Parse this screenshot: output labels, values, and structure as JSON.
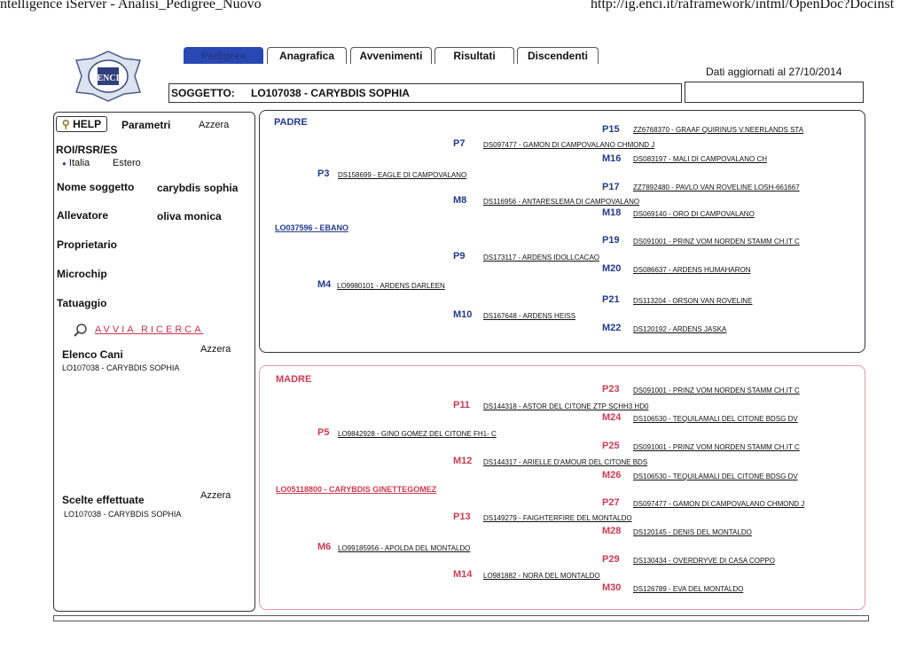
{
  "browser": {
    "title": "ntelligence iServer - Analisi_Pedigree_Nuovo",
    "url": "http://ig.enci.it/raframework/intml/OpenDoc?Docinst"
  },
  "tabs": [
    {
      "label": "Pedigree"
    },
    {
      "label": "Anagrafica"
    },
    {
      "label": "Avvenimenti"
    },
    {
      "label": "Risultati"
    },
    {
      "label": "Discendenti"
    }
  ],
  "updated": "Dati aggiornati al 27/10/2014",
  "subject": {
    "label": "SOGGETTO:",
    "value": "LO107038 - CARYBDIS SOPHIA"
  },
  "left": {
    "help": "HELP",
    "parametri": "Parametri",
    "azzera": "Azzera",
    "roi": "ROI/RSR/ES",
    "italia": "Italia",
    "estero": "Estero",
    "nome_label": "Nome soggetto",
    "nome_value": "carybdis sophia",
    "allevatore_label": "Allevatore",
    "allevatore_value": "oliva monica",
    "proprietario": "Proprietario",
    "microchip": "Microchip",
    "tatuaggio": "Tatuaggio",
    "search": "AVVIA RICERCA",
    "elenco": "Elenco Cani",
    "elenco_item": "LO107038 - CARYBDIS SOPHIA",
    "scelte": "Scelte effettuate",
    "scelte_item": "LO107038 - CARYBDIS SOPHIA"
  },
  "padre": {
    "title": "PADRE",
    "sire": "LO037596 - EBANO",
    "entries": [
      {
        "code": "P15",
        "name": "ZZ6768370 - GRAAF QUIRINUS V.NEERLANDS STA"
      },
      {
        "code": "P7",
        "name": "DS097477 - GAMON DI CAMPOVALANO CHMOND J"
      },
      {
        "code": "M16",
        "name": "DS083197 - MALI DI CAMPOVALANO CH"
      },
      {
        "code": "P3",
        "name": "DS158699 - EAGLE DI CAMPOVALANO"
      },
      {
        "code": "P17",
        "name": "ZZ7892480 - PAVLO VAN ROVELINE LOSH-661667"
      },
      {
        "code": "M8",
        "name": "DS116956 - ANTARESLEMA DI CAMPOVALANO"
      },
      {
        "code": "M18",
        "name": "DS069140 - ORO DI CAMPOVALANO"
      },
      {
        "code": "P19",
        "name": "DS091001 - PRINZ VOM NORDEN STAMM CH.IT C"
      },
      {
        "code": "P9",
        "name": "DS173117 - ARDENS IDOLLCACAO"
      },
      {
        "code": "M20",
        "name": "DS086637 - ARDENS HUMAHARON"
      },
      {
        "code": "M4",
        "name": "LO9980101 - ARDENS DARLEEN"
      },
      {
        "code": "P21",
        "name": "DS113204 - ORSON VAN ROVELINE"
      },
      {
        "code": "M10",
        "name": "DS167648 - ARDENS HEISS"
      },
      {
        "code": "M22",
        "name": "DS120192 - ARDENS JASKA"
      }
    ]
  },
  "madre": {
    "title": "MADRE",
    "dam": "LO05118800 - CARYBDIS GINETTEGOMEZ",
    "entries": [
      {
        "code": "P23",
        "name": "DS091001 - PRINZ VOM NORDEN STAMM CH.IT C"
      },
      {
        "code": "P11",
        "name": "DS144318 - ASTOR DEL CITONE ZTP SCHH3 HD0"
      },
      {
        "code": "M24",
        "name": "DS106530 - TEQUILAMALI DEL CITONE BDSG DV"
      },
      {
        "code": "P5",
        "name": "LO9842928 - GINO GOMEZ DEL CITONE  FH1- C"
      },
      {
        "code": "P25",
        "name": "DS091001 - PRINZ VOM NORDEN STAMM CH.IT C"
      },
      {
        "code": "M12",
        "name": "DS144317 - ARIELLE D'AMOUR DEL CITONE BDS"
      },
      {
        "code": "M26",
        "name": "DS106530 - TEQUILAMALI DEL CITONE BDSG DV"
      },
      {
        "code": "P27",
        "name": "DS097477 - GAMON DI CAMPOVALANO CHMOND J"
      },
      {
        "code": "P13",
        "name": "DS149279 - FAIGHTERFIRE DEL MONTALDO"
      },
      {
        "code": "M28",
        "name": "DS120145 - DENIS DEL MONTALDO"
      },
      {
        "code": "M6",
        "name": "LO99185956 - APOLDA DEL MONTALDO"
      },
      {
        "code": "P29",
        "name": "DS130434 - OVERDRYVE DI CASA COPPO"
      },
      {
        "code": "M14",
        "name": "LO981882 - NORA DEL MONTALDO"
      },
      {
        "code": "M30",
        "name": "DS126789 - EVA DEL MONTALDO"
      }
    ]
  }
}
